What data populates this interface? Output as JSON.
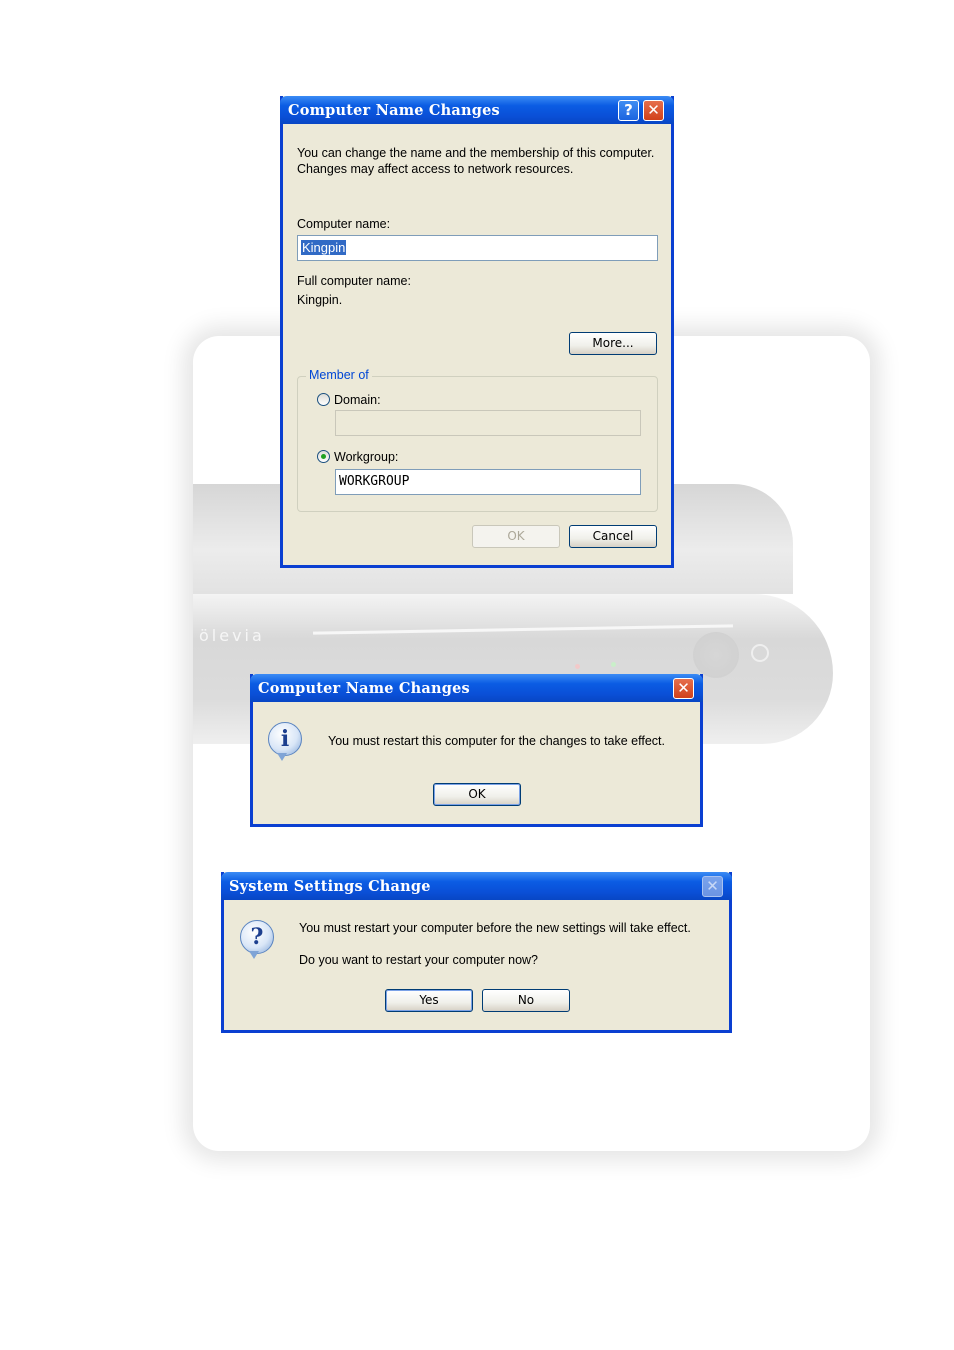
{
  "dialog1": {
    "title": "Computer Name Changes",
    "help_icon": "help-icon",
    "close_icon": "close-icon",
    "description": "You can change the name and the membership of this computer. Changes may affect access to network resources.",
    "computer_name_label": "Computer name:",
    "computer_name_value": "Kingpin",
    "full_name_label": "Full computer name:",
    "full_name_value": "Kingpin.",
    "more_label": "More...",
    "member_of_label": "Member of",
    "domain_label": "Domain:",
    "domain_value": "",
    "workgroup_label": "Workgroup:",
    "workgroup_value": "WORKGROUP",
    "selected_membership": "Workgroup",
    "ok_label": "OK",
    "cancel_label": "Cancel"
  },
  "dialog2": {
    "title": "Computer Name Changes",
    "close_icon": "close-icon",
    "icon": "info-icon",
    "message": "You must restart this computer for the changes to take effect.",
    "ok_label": "OK"
  },
  "dialog3": {
    "title": "System Settings Change",
    "close_icon": "close-icon",
    "icon": "question-icon",
    "message1": "You must restart your computer before the new settings will take effect.",
    "message2": "Do you want to restart your computer now?",
    "yes_label": "Yes",
    "no_label": "No"
  },
  "background": {
    "brand": "ölevia"
  },
  "colors": {
    "titlebar": "#0a50d8",
    "dialog_bg": "#ece9d8",
    "close_button": "#d1401a",
    "selection": "#316ac5"
  }
}
